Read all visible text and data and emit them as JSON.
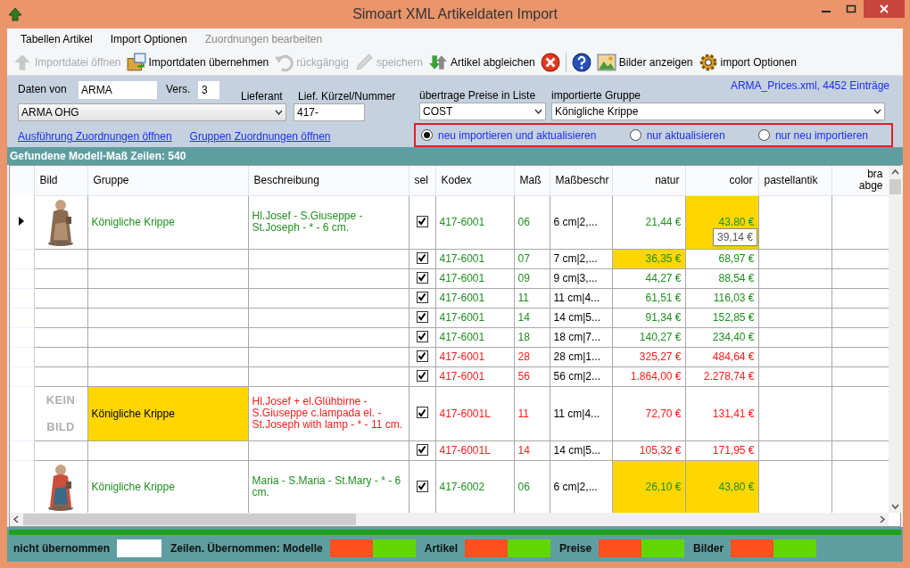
{
  "window": {
    "title": "Simoart XML Artikeldaten Import"
  },
  "menu": [
    {
      "label": "Tabellen Artikel",
      "disabled": false
    },
    {
      "label": "Import Optionen",
      "disabled": false
    },
    {
      "label": "Zuordnungen bearbeiten",
      "disabled": true
    }
  ],
  "toolbar": [
    {
      "kind": "upload",
      "label": "Importdatei öffnen",
      "disabled": true
    },
    {
      "kind": "import",
      "label": "Importdaten übernehmen",
      "disabled": false
    },
    {
      "kind": "undo",
      "label": "rückgängig",
      "disabled": true
    },
    {
      "kind": "pencil",
      "label": "speichern",
      "disabled": true
    },
    {
      "kind": "compare",
      "label": "Artikel abgleichen",
      "disabled": false
    },
    {
      "kind": "cancel",
      "disabled": false
    },
    {
      "kind": "separator"
    },
    {
      "kind": "help",
      "disabled": false
    },
    {
      "kind": "images",
      "label": "Bilder anzeigen",
      "disabled": false
    },
    {
      "kind": "gear",
      "label": "import Optionen",
      "disabled": false
    }
  ],
  "form": {
    "daten_von_label": "Daten von",
    "daten_von": "ARMA",
    "vers_label": "Vers.",
    "vers": "3",
    "lieferant_label": "Lieferant",
    "lieferant": "ARMA OHG",
    "kuerzel_label": "Lief. Kürzel/Nummer",
    "kuerzel": "417-",
    "preisliste_label": "übertrage Preise in Liste",
    "preisliste": "COST",
    "gruppe_label": "importierte Gruppe",
    "gruppe": "Königliche Krippe",
    "file_info": "ARMA_Prices.xml, 4452 Einträge",
    "links": [
      "Ausführung Zuordnungen öffnen",
      "Gruppen Zuordnungen öffnen"
    ],
    "modes": [
      {
        "label": "neu importieren und aktualisieren",
        "selected": true
      },
      {
        "label": "nur aktualisieren",
        "selected": false
      },
      {
        "label": "nur neu importieren",
        "selected": false
      }
    ]
  },
  "section_title": "Gefundene Modell-Maß Zeilen: 540",
  "table": {
    "columns": [
      "Bild",
      "Gruppe",
      "Beschreibung",
      "sel",
      "Kodex",
      "Maß",
      "Maßbeschr",
      "natur",
      "color",
      "pastellantik",
      "bra abge"
    ],
    "rows": [
      {
        "current": true,
        "color": "#1f8f1f",
        "gruppe": {
          "text": "Königliche Krippe",
          "highlight": false
        },
        "beschreibung": "Hl.Josef - S.Giuseppe - St.Joseph - * - 6 cm.",
        "sel": true,
        "kodex": "417-6001",
        "mass": "06",
        "massbeschr": "6 cm|2,...",
        "natur": {
          "text": "21,44 €",
          "highlight": false
        },
        "colorprice": {
          "text": "43.80 €",
          "highlight": true
        },
        "tooltip": "39,14 €"
      },
      {
        "current": false,
        "color": "#1f8f1f",
        "sel": true,
        "kodex": "417-6001",
        "mass": "07",
        "massbeschr": "7 cm|2,...",
        "natur": {
          "text": "36,35 €",
          "highlight": true
        },
        "colorprice": {
          "text": "68,97 €",
          "highlight": false
        }
      },
      {
        "current": false,
        "color": "#1f8f1f",
        "sel": true,
        "kodex": "417-6001",
        "mass": "09",
        "massbeschr": "9 cm|3,...",
        "natur": {
          "text": "44,27 €",
          "highlight": false
        },
        "colorprice": {
          "text": "88,54 €",
          "highlight": false
        }
      },
      {
        "current": false,
        "color": "#1f8f1f",
        "sel": true,
        "kodex": "417-6001",
        "mass": "11",
        "massbeschr": "11 cm|4...",
        "natur": {
          "text": "61,51 €",
          "highlight": false
        },
        "colorprice": {
          "text": "116,03 €",
          "highlight": false
        }
      },
      {
        "current": false,
        "color": "#1f8f1f",
        "sel": true,
        "kodex": "417-6001",
        "mass": "14",
        "massbeschr": "14 cm|5...",
        "natur": {
          "text": "91,34 €",
          "highlight": false
        },
        "colorprice": {
          "text": "152,85 €",
          "highlight": false
        }
      },
      {
        "current": false,
        "color": "#1f8f1f",
        "sel": true,
        "kodex": "417-6001",
        "mass": "18",
        "massbeschr": "18 cm|7...",
        "natur": {
          "text": "140,27 €",
          "highlight": false
        },
        "colorprice": {
          "text": "234,40 €",
          "highlight": false
        }
      },
      {
        "current": false,
        "color": "#ff1a1a",
        "sel": true,
        "kodex": "417-6001",
        "mass": "28",
        "massbeschr": "28 cm|1...",
        "natur": {
          "text": "325,27 €",
          "highlight": false
        },
        "colorprice": {
          "text": "484,64 €",
          "highlight": false
        }
      },
      {
        "current": false,
        "color": "#ff1a1a",
        "sel": true,
        "kodex": "417-6001",
        "mass": "56",
        "massbeschr": "56 cm|2...",
        "natur": {
          "text": "1.864,00 €",
          "highlight": false
        },
        "colorprice": {
          "text": "2.278,74 €",
          "highlight": false
        }
      },
      {
        "current": false,
        "image": {
          "kind": "text",
          "text": "KEIN BILD"
        },
        "color": "#ff1a1a",
        "gruppe": {
          "text": "Königliche Krippe",
          "highlight": true
        },
        "beschreibung": "Hl.Josef + el.Glühbirne - S.Giuseppe c.lampada el. - St.Joseph with lamp - * - 11 cm.",
        "sel": true,
        "kodex": "417-6001L",
        "mass": "11",
        "massbeschr": "11 cm|4...",
        "natur": {
          "text": "72,70 €",
          "highlight": false
        },
        "colorprice": {
          "text": "131,41 €",
          "highlight": false
        }
      },
      {
        "current": false,
        "color": "#ff1a1a",
        "sel": true,
        "kodex": "417-6001L",
        "mass": "14",
        "massbeschr": "14 cm|5...",
        "natur": {
          "text": "105,32 €",
          "highlight": false
        },
        "colorprice": {
          "text": "171,95 €",
          "highlight": false
        }
      },
      {
        "current": false,
        "color": "#1f8f1f",
        "gruppe": {
          "text": "Königliche Krippe",
          "highlight": false
        },
        "beschreibung": "Maria - S.Maria - St.Mary - * - 6 cm.",
        "sel": true,
        "kodex": "417-6002",
        "mass": "06",
        "massbeschr": "6 cm|2,...",
        "natur": {
          "text": "26,10 €",
          "highlight": true
        },
        "colorprice": {
          "text": "43,80 €",
          "highlight": true
        }
      }
    ]
  },
  "progress": {
    "level": 1
  },
  "legend": [
    {
      "label": "nicht übernommen",
      "swatches": [
        {
          "color": "#ffffff"
        }
      ]
    },
    {
      "label": "Zeilen. Übernommen: Modelle",
      "swatches": [
        {
          "color": "#ff5020"
        },
        {
          "color": "#60d800"
        }
      ]
    },
    {
      "label": "Artikel",
      "swatches": [
        {
          "color": "#ff5020"
        },
        {
          "color": "#60d800"
        }
      ]
    },
    {
      "label": "Preise",
      "swatches": [
        {
          "color": "#ff5020"
        },
        {
          "color": "#60d800"
        }
      ]
    },
    {
      "label": "Bilder",
      "swatches": [
        {
          "color": "#ff5020"
        },
        {
          "color": "#60d800"
        }
      ]
    }
  ]
}
